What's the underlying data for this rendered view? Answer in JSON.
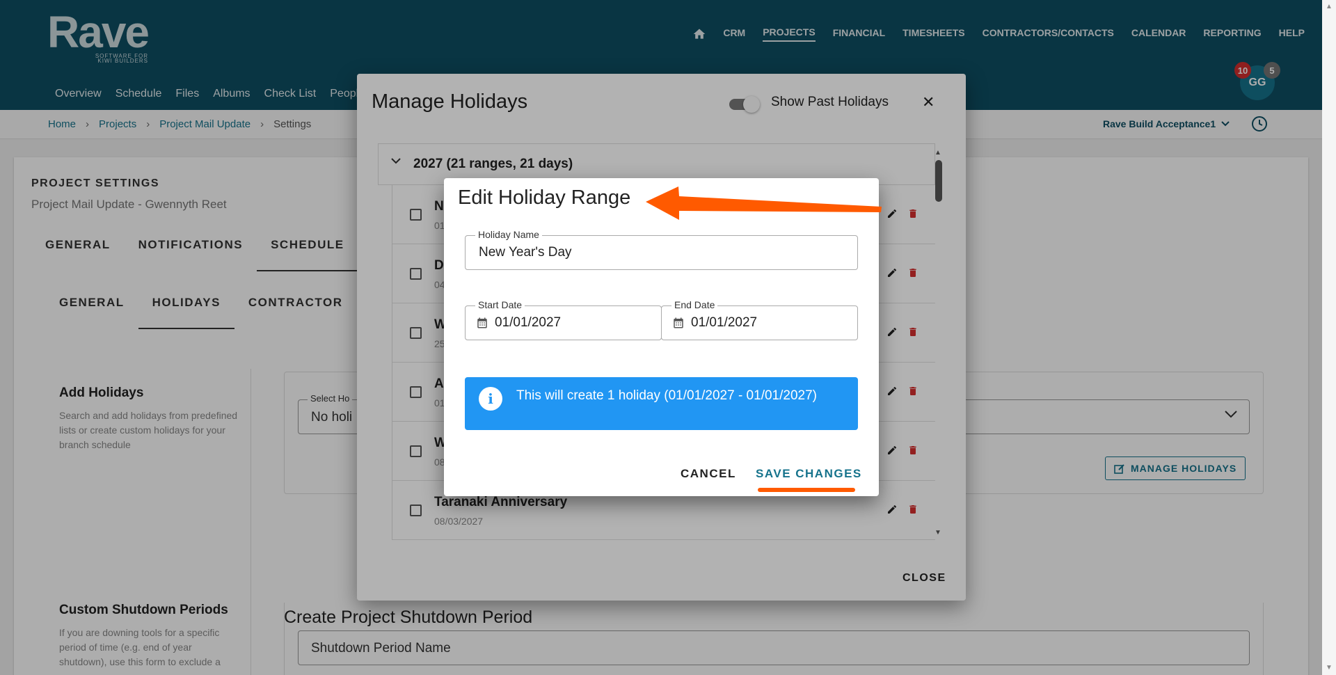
{
  "brand": {
    "name": "Rave",
    "tagline_line1": "SOFTWARE FOR",
    "tagline_line2": "KIWI BUILDERS"
  },
  "main_nav": [
    {
      "label": "CRM"
    },
    {
      "label": "PROJECTS",
      "active": true
    },
    {
      "label": "FINANCIAL"
    },
    {
      "label": "TIMESHEETS"
    },
    {
      "label": "CONTRACTORS/CONTACTS"
    },
    {
      "label": "CALENDAR"
    },
    {
      "label": "REPORTING"
    },
    {
      "label": "HELP"
    }
  ],
  "sub_nav": [
    "Overview",
    "Schedule",
    "Files",
    "Albums",
    "Check List",
    "People"
  ],
  "user": {
    "initials": "GG",
    "badge_red": "10",
    "badge_grey": "5"
  },
  "breadcrumb": {
    "items": [
      "Home",
      "Projects",
      "Project Mail Update"
    ],
    "current": "Settings"
  },
  "project_selector": "Rave Build Acceptance1",
  "settings": {
    "title": "PROJECT SETTINGS",
    "subtitle": "Project Mail Update - Gwennyth Reet",
    "tabs": [
      "GENERAL",
      "NOTIFICATIONS",
      "SCHEDULE"
    ],
    "subtabs": [
      "GENERAL",
      "HOLIDAYS",
      "CONTRACTOR"
    ],
    "add_holidays": {
      "title": "Add Holidays",
      "desc": "Search and add holidays from predefined lists or create custom holidays for your branch schedule",
      "select_label": "Select Ho",
      "select_value": "No holi",
      "manage_button": "MANAGE HOLIDAYS"
    },
    "shutdown": {
      "title": "Custom Shutdown Periods",
      "desc": "If you are downing tools for a specific period of time (e.g. end of year shutdown), use this form to exclude a",
      "form_title": "Create Project Shutdown Period",
      "placeholder": "Shutdown Period Name"
    }
  },
  "manage_dialog": {
    "title": "Manage Holidays",
    "toggle_label": "Show Past Holidays",
    "close_x": "✕",
    "year_header": "2027 (21 ranges, 21 days)",
    "rows": [
      {
        "name": "N",
        "date": "01"
      },
      {
        "name": "D",
        "date": "04"
      },
      {
        "name": "W",
        "date": "25"
      },
      {
        "name": "A",
        "date": "01"
      },
      {
        "name": "W",
        "date": "08"
      },
      {
        "name": "Taranaki Anniversary",
        "date": "08/03/2027"
      }
    ],
    "close_button": "CLOSE"
  },
  "edit_dialog": {
    "title": "Edit Holiday Range",
    "holiday_name_label": "Holiday Name",
    "holiday_name_value": "New Year's Day",
    "start_label": "Start Date",
    "start_value": "01/01/2027",
    "end_label": "End Date",
    "end_value": "01/01/2027",
    "info_text": "This will create 1 holiday (01/01/2027 - 01/01/2027)",
    "cancel": "CANCEL",
    "save": "SAVE CHANGES"
  },
  "colors": {
    "header": "#0e4e63",
    "accent": "#16738c",
    "info": "#2196f3",
    "annotation": "#ff5a00",
    "delete": "#d32f2f"
  }
}
